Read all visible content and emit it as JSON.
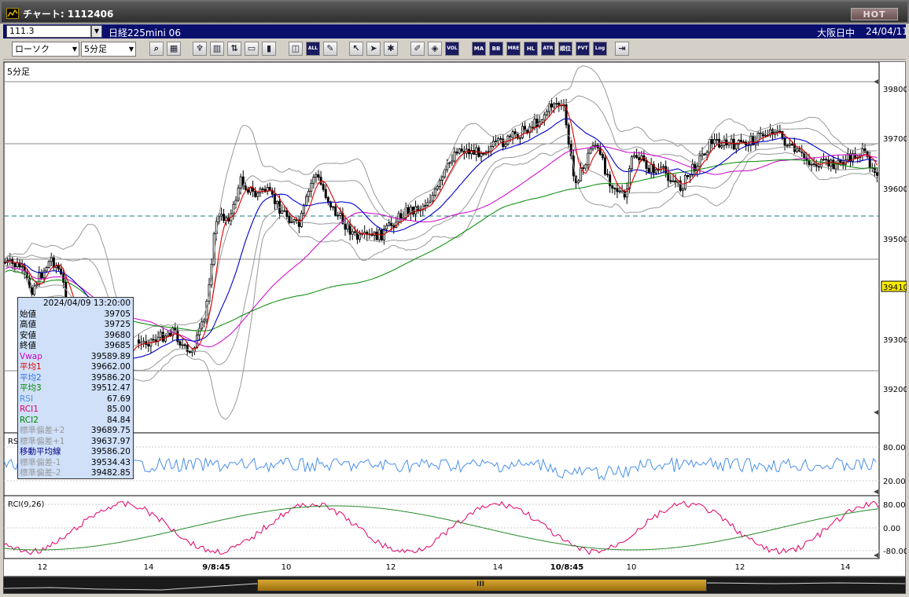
{
  "window": {
    "title": "チャート: 1112406",
    "hot_label": "HOT"
  },
  "infobar": {
    "code": "111.3",
    "symbol": "日経225mini 06",
    "market_status": "大阪日中",
    "date": "24/04/11"
  },
  "toolbar": {
    "chart_type": "ローソク",
    "timeframe": "5分足",
    "buttons": [
      "search",
      "layout",
      "candle-mark",
      "ohlc",
      "sell-buy",
      "blank",
      "candle",
      "box",
      "all",
      "pen",
      "cursor",
      "arrow",
      "gear",
      "brush",
      "palette",
      "vol",
      "ma",
      "bb",
      "mre",
      "hl",
      "atr",
      "rank",
      "pvt",
      "log",
      "exit"
    ],
    "text_labels": {
      "all": "ALL",
      "vol": "VOL",
      "ma": "MA",
      "bb": "BB",
      "mre": "MRE",
      "hl": "HL",
      "atr": "ATR",
      "rank": "順位",
      "pvt": "PVT",
      "log": "Log"
    }
  },
  "chart": {
    "period_label": "5分足",
    "price_axis": [
      "39800",
      "39700",
      "39600",
      "39500",
      "39400",
      "39300",
      "39200"
    ],
    "current_price": "39410",
    "rsi_axis": [
      "80.00",
      "20.00"
    ],
    "rsi_label": "RSI",
    "rci_label": "RCI(9,26)",
    "rci_axis": [
      "80.00",
      "0.00",
      "-80.00"
    ],
    "x_labels": [
      "12",
      "14",
      "9/8:45",
      "10",
      "12",
      "14",
      "10/8:45",
      "10",
      "12",
      "14"
    ],
    "colors": {
      "candle": "#000000",
      "ma1": "#e00000",
      "ma2": "#0000cc",
      "ma3": "#008800",
      "vwap": "#cc00cc",
      "bands": "#999999",
      "rsi": "#4a90e8",
      "rci1": "#e0006a",
      "rci2": "#2a8a2a",
      "dashed": "#1a7a7a"
    }
  },
  "tooltip": {
    "datetime": "2024/04/09  13:20:00",
    "rows": [
      {
        "label": "始値",
        "value": "39705",
        "color": "#000000"
      },
      {
        "label": "高値",
        "value": "39725",
        "color": "#000000"
      },
      {
        "label": "安値",
        "value": "39680",
        "color": "#000000"
      },
      {
        "label": "終値",
        "value": "39685",
        "color": "#000000"
      },
      {
        "label": "Vwap",
        "value": "39589.89",
        "color": "#cc00cc"
      },
      {
        "label": "平均1",
        "value": "39662.00",
        "color": "#e00000"
      },
      {
        "label": "平均2",
        "value": "39586.20",
        "color": "#3070e0"
      },
      {
        "label": "平均3",
        "value": "39512.47",
        "color": "#008800"
      },
      {
        "label": "RSI",
        "value": "67.69",
        "color": "#4a90e8"
      },
      {
        "label": "RCI1",
        "value": "85.00",
        "color": "#e0006a"
      },
      {
        "label": "RCI2",
        "value": "84.84",
        "color": "#008800"
      },
      {
        "label": "標準偏差+2",
        "value": "39689.75",
        "color": "#999999"
      },
      {
        "label": "標準偏差+1",
        "value": "39637.97",
        "color": "#999999"
      },
      {
        "label": "移動平均線",
        "value": "39586.20",
        "color": "#000080"
      },
      {
        "label": "標準偏差-1",
        "value": "39534.43",
        "color": "#999999"
      },
      {
        "label": "標準偏差-2",
        "value": "39482.85",
        "color": "#999999"
      }
    ]
  },
  "scroll": {
    "grip": "III"
  }
}
